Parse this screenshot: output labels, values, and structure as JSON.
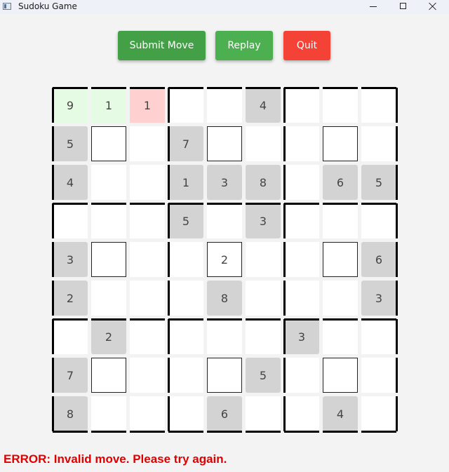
{
  "window": {
    "title": "Sudoku Game"
  },
  "toolbar": {
    "submit_label": "Submit Move",
    "replay_label": "Replay",
    "quit_label": "Quit"
  },
  "board": {
    "cells": [
      [
        "9",
        "1",
        "1",
        "",
        "",
        "4",
        "",
        "",
        ""
      ],
      [
        "5",
        "",
        "",
        "7",
        "",
        "",
        "",
        "",
        ""
      ],
      [
        "4",
        "",
        "",
        "1",
        "3",
        "8",
        "",
        "6",
        "5"
      ],
      [
        "",
        "",
        "",
        "5",
        "",
        "3",
        "",
        "",
        ""
      ],
      [
        "3",
        "",
        "",
        "",
        "2",
        "",
        "",
        "",
        "6"
      ],
      [
        "2",
        "",
        "",
        "",
        "8",
        "",
        "",
        "",
        "3"
      ],
      [
        "",
        "2",
        "",
        "",
        "",
        "",
        "3",
        "",
        ""
      ],
      [
        "7",
        "",
        "",
        "",
        "",
        "5",
        "",
        "",
        ""
      ],
      [
        "8",
        "",
        "",
        "",
        "6",
        "",
        "",
        "4",
        ""
      ]
    ]
  },
  "status": {
    "error_message": "ERROR: Invalid move. Please try again."
  },
  "colors": {
    "submit": "#43a047",
    "replay": "#4caf50",
    "quit": "#f44336",
    "error_text": "#e00000",
    "given_cell": "#d3d3d3",
    "valid_cell": "#e6fbe3",
    "invalid_cell": "#ffd0d0"
  }
}
